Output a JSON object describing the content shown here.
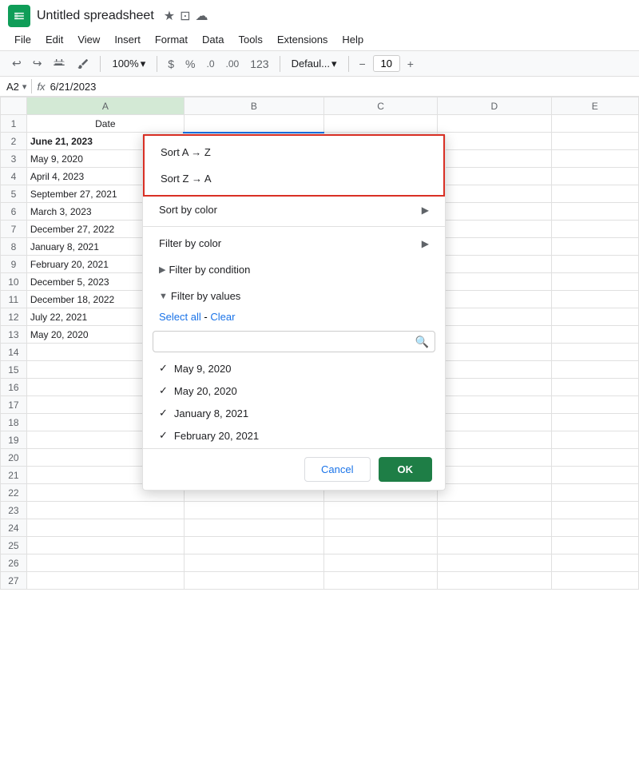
{
  "titleBar": {
    "appName": "Untitled spreadsheet",
    "starIcon": "★",
    "cameraIcon": "⊡",
    "cloudIcon": "☁"
  },
  "menuBar": {
    "items": [
      "File",
      "Edit",
      "View",
      "Insert",
      "Format",
      "Data",
      "Tools",
      "Extensions",
      "Help"
    ]
  },
  "toolbar": {
    "undo": "↩",
    "redo": "↪",
    "print": "🖨",
    "format": "⊞",
    "zoom": "100%",
    "zoomArrow": "▾",
    "dollar": "$",
    "percent": "%",
    "decimal1": ".0",
    "decimal2": ".00",
    "number": "123",
    "fontDefault": "Defaul...",
    "fontArrow": "▾",
    "minus": "−",
    "fontSize": "10",
    "plus": "+"
  },
  "formulaBar": {
    "cellRef": "A2",
    "arrow": "▾",
    "fx": "fx",
    "formula": "6/21/2023"
  },
  "columns": {
    "rowHeader": "",
    "headers": [
      "A",
      "B",
      "C",
      "D",
      "E"
    ],
    "colA": "Date"
  },
  "rows": [
    {
      "row": "1",
      "a": "Date",
      "b": "",
      "c": "",
      "d": "",
      "e": ""
    },
    {
      "row": "2",
      "a": "June 21, 2023",
      "b": "",
      "c": "",
      "d": "",
      "e": ""
    },
    {
      "row": "3",
      "a": "May 9, 2020",
      "b": "",
      "c": "",
      "d": "",
      "e": ""
    },
    {
      "row": "4",
      "a": "April 4, 2023",
      "b": "",
      "c": "",
      "d": "",
      "e": ""
    },
    {
      "row": "5",
      "a": "September 27, 2021",
      "b": "",
      "c": "",
      "d": "",
      "e": ""
    },
    {
      "row": "6",
      "a": "March 3, 2023",
      "b": "",
      "c": "",
      "d": "",
      "e": ""
    },
    {
      "row": "7",
      "a": "December 27, 2022",
      "b": "",
      "c": "",
      "d": "",
      "e": ""
    },
    {
      "row": "8",
      "a": "January 8, 2021",
      "b": "",
      "c": "",
      "d": "",
      "e": ""
    },
    {
      "row": "9",
      "a": "February 20, 2021",
      "b": "",
      "c": "",
      "d": "",
      "e": ""
    },
    {
      "row": "10",
      "a": "December 5, 2023",
      "b": "",
      "c": "",
      "d": "",
      "e": ""
    },
    {
      "row": "11",
      "a": "December 18, 2022",
      "b": "",
      "c": "",
      "d": "",
      "e": ""
    },
    {
      "row": "12",
      "a": "July 22, 2021",
      "b": "",
      "c": "",
      "d": "",
      "e": ""
    },
    {
      "row": "13",
      "a": "May 20, 2020",
      "b": "",
      "c": "",
      "d": "",
      "e": ""
    },
    {
      "row": "14",
      "a": "",
      "b": "",
      "c": "",
      "d": "",
      "e": ""
    },
    {
      "row": "15",
      "a": "",
      "b": "",
      "c": "",
      "d": "",
      "e": ""
    },
    {
      "row": "16",
      "a": "",
      "b": "",
      "c": "",
      "d": "",
      "e": ""
    },
    {
      "row": "17",
      "a": "",
      "b": "",
      "c": "",
      "d": "",
      "e": ""
    },
    {
      "row": "18",
      "a": "",
      "b": "",
      "c": "",
      "d": "",
      "e": ""
    },
    {
      "row": "19",
      "a": "",
      "b": "",
      "c": "",
      "d": "",
      "e": ""
    },
    {
      "row": "20",
      "a": "",
      "b": "",
      "c": "",
      "d": "",
      "e": ""
    },
    {
      "row": "21",
      "a": "",
      "b": "",
      "c": "",
      "d": "",
      "e": ""
    },
    {
      "row": "22",
      "a": "",
      "b": "",
      "c": "",
      "d": "",
      "e": ""
    },
    {
      "row": "23",
      "a": "",
      "b": "",
      "c": "",
      "d": "",
      "e": ""
    },
    {
      "row": "24",
      "a": "",
      "b": "",
      "c": "",
      "d": "",
      "e": ""
    },
    {
      "row": "25",
      "a": "",
      "b": "",
      "c": "",
      "d": "",
      "e": ""
    },
    {
      "row": "26",
      "a": "",
      "b": "",
      "c": "",
      "d": "",
      "e": ""
    },
    {
      "row": "27",
      "a": "",
      "b": "",
      "c": "",
      "d": "",
      "e": ""
    }
  ],
  "dropdown": {
    "sortAZ": "Sort A → Z",
    "sortZA": "Sort Z → A",
    "sortByColor": "Sort by color",
    "filterByColor": "Filter by color",
    "filterByConditionPrefix": "▶",
    "filterByCondition": "Filter by condition",
    "filterByValuesPrefix": "▼",
    "filterByValues": "Filter by values",
    "selectAll": "Select all",
    "clear": "Clear",
    "searchPlaceholder": "",
    "filterItems": [
      {
        "label": "May 9, 2020",
        "checked": true
      },
      {
        "label": "May 20, 2020",
        "checked": true
      },
      {
        "label": "January 8, 2021",
        "checked": true
      },
      {
        "label": "February 20, 2021",
        "checked": true
      }
    ],
    "cancelLabel": "Cancel",
    "okLabel": "OK"
  }
}
